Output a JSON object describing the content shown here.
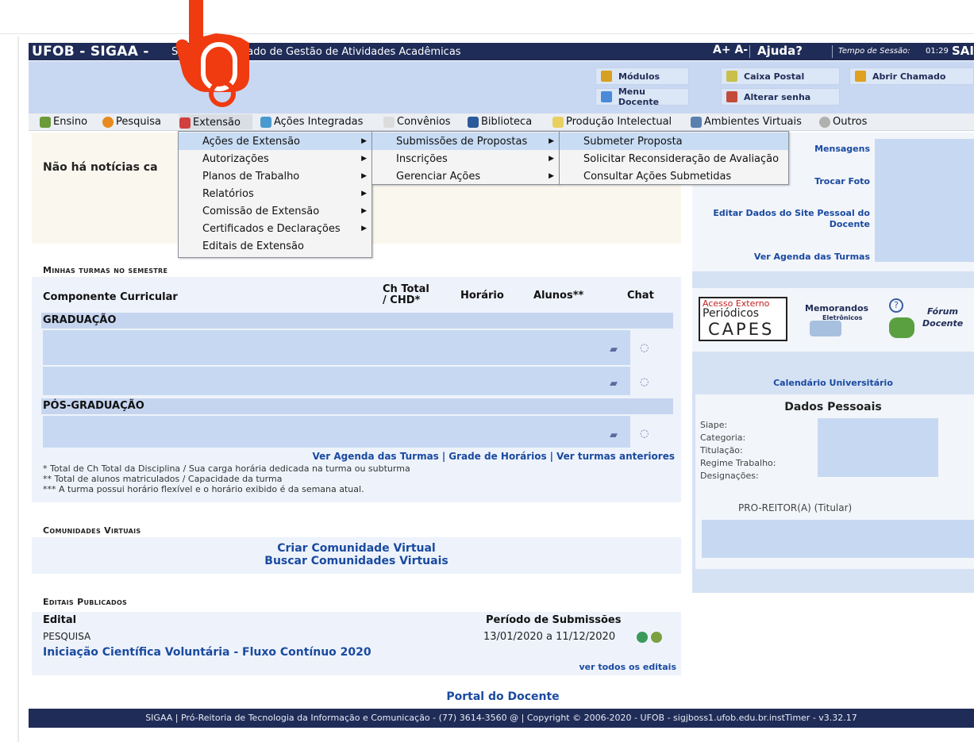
{
  "header": {
    "app_name": "UFOB - SIGAA -",
    "app_description": "Sistema Integrado de Gestão de Atividades Acadêmicas",
    "font_controls": "A+ A-",
    "help": "Ajuda?",
    "session_label": "Tempo de Sessão:",
    "session_time": "01:29",
    "exit": "SAIR"
  },
  "modules": {
    "modulos": "Módulos",
    "caixa_postal": "Caixa Postal",
    "abrir_chamado": "Abrir Chamado",
    "menu_docente": "Menu Docente",
    "alterar_senha": "Alterar senha"
  },
  "menubar": {
    "items": [
      "Ensino",
      "Pesquisa",
      "Extensão",
      "Ações Integradas",
      "Convênios",
      "Biblioteca",
      "Produção Intelectual",
      "Ambientes Virtuais",
      "Outros"
    ]
  },
  "dropdown1": {
    "items": [
      "Ações de Extensão",
      "Autorizações",
      "Planos de Trabalho",
      "Relatórios",
      "Comissão de Extensão",
      "Certificados e Declarações",
      "Editais de Extensão"
    ]
  },
  "dropdown2": {
    "items": [
      "Submissões de Propostas",
      "Inscrições",
      "Gerenciar Ações"
    ]
  },
  "dropdown3": {
    "items": [
      "Submeter Proposta",
      "Solicitar Reconsideração de Avaliação",
      "Consultar Ações Submetidas"
    ]
  },
  "news": {
    "text": "Não há notícias ca"
  },
  "right": {
    "mensagens": "Mensagens",
    "trocar_foto": "Trocar Foto",
    "editar_site_1": "Editar Dados do Site Pessoal do",
    "editar_site_2": "Docente",
    "ver_agenda": "Ver Agenda das Turmas",
    "calendario": "Calendário Universitário",
    "dados_pessoais": "Dados Pessoais",
    "fields": [
      "Siape:",
      "Categoria:",
      "Titulação:",
      "Regime Trabalho:",
      "Designações:"
    ],
    "pro_reitor": "PRO-REITOR(A) (Titular)",
    "banner_capes_1": "Acesso Externo",
    "banner_capes_2": "Periódicos",
    "banner_capes_3": "CAPES",
    "banner_memo_1": "Memorandos",
    "banner_memo_2": "Eletrônicos",
    "banner_forum_1": "Fórum",
    "banner_forum_2": "Docente"
  },
  "turmas": {
    "section_title": "Minhas turmas no semestre",
    "col_componente": "Componente Curricular",
    "col_ch_1": "Ch Total",
    "col_ch_2": "/ CHD*",
    "col_horario": "Horário",
    "col_alunos": "Alunos**",
    "col_chat": "Chat",
    "grp_graduacao": "GRADUAÇÃO",
    "grp_pos": "PÓS-GRADUAÇÃO",
    "link_agenda": "Ver Agenda das Turmas",
    "link_grade": "Grade de Horários",
    "link_anteriores": "Ver turmas anteriores",
    "link_sep": "|",
    "note1": "* Total de Ch Total da Disciplina / Sua carga horária dedicada na turma ou subturma",
    "note2": "** Total de alunos matriculados / Capacidade da turma",
    "note3": "*** A turma possui horário flexível e o horário exibido é da semana atual."
  },
  "comunidades": {
    "section_title": "Comunidades Virtuais",
    "criar": "Criar Comunidade Virtual",
    "buscar": "Buscar Comunidades Virtuais"
  },
  "editais": {
    "section_title": "Editais Publicados",
    "col_edital": "Edital",
    "col_periodo": "Período de Submissões",
    "row_tipo": "PESQUISA",
    "row_nome": "Iniciação Científica Voluntária - Fluxo Contínuo 2020",
    "row_periodo": "13/01/2020 a 11/12/2020",
    "ver_todos": "ver todos os editais"
  },
  "portal": "Portal do Docente",
  "footer": "SIGAA | Pró-Reitoria de Tecnologia da Informação e Comunicação - (77) 3614-3560 @ | Copyright © 2006-2020 - UFOB - sigjboss1.ufob.edu.br.instTimer - v3.32.17",
  "colors": {
    "navy": "#1f2c57",
    "link_blue": "#1a4aa0",
    "light_blue": "#c9d8f2",
    "pointer_red": "#f03a10"
  }
}
